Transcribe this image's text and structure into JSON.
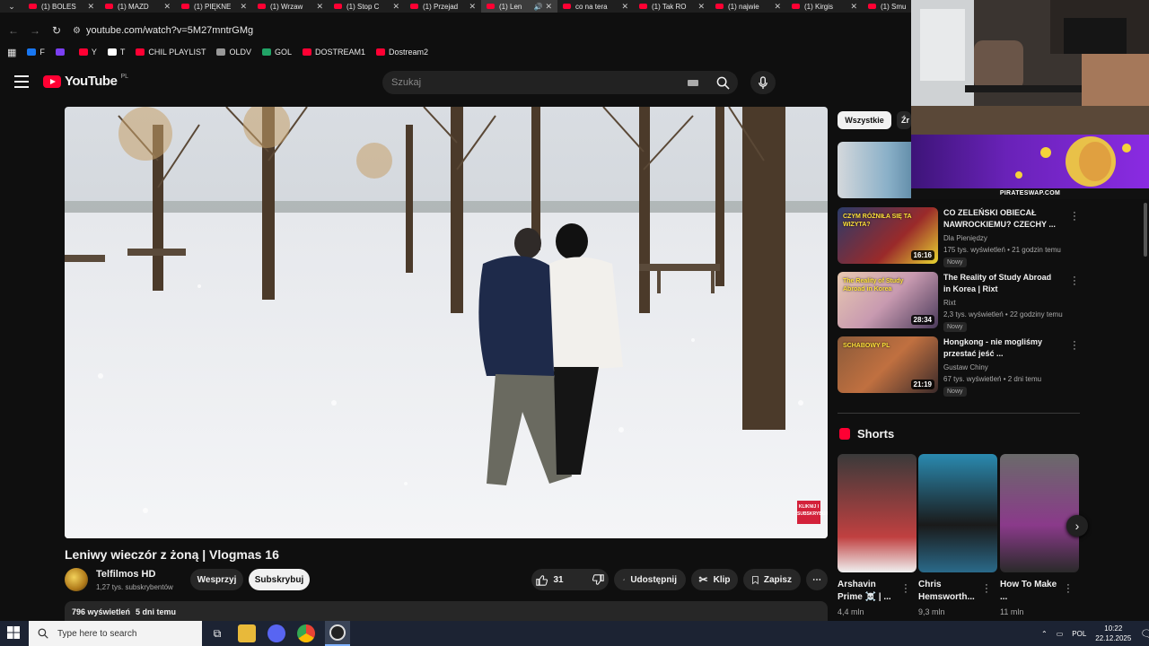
{
  "browser": {
    "tabs": [
      {
        "label": "(1) BOLES"
      },
      {
        "label": "(1) MAZD"
      },
      {
        "label": "(1) PIĘKNE"
      },
      {
        "label": "(1) Wrzaw"
      },
      {
        "label": "(1) Stop C"
      },
      {
        "label": "(1) Przejad"
      },
      {
        "label": "(1) Len",
        "active": true
      },
      {
        "label": "co na tera"
      },
      {
        "label": "(1) Tak RO"
      },
      {
        "label": "(1) najwie"
      },
      {
        "label": "(1) Kirgis"
      },
      {
        "label": "(1) Smu"
      }
    ],
    "url": "youtube.com/watch?v=5M27mntrGMg",
    "bookmarks": [
      {
        "label": "F",
        "color": "#1877f2"
      },
      {
        "label": "",
        "color": "#7b3ff2"
      },
      {
        "label": "Y",
        "color": "#ff0033"
      },
      {
        "label": "T",
        "color": "#ffffff"
      },
      {
        "label": "CHIL PLAYLIST",
        "color": "#ff0033"
      },
      {
        "label": "OLDV",
        "color": "#999999"
      },
      {
        "label": "GOL",
        "color": "#21a366"
      },
      {
        "label": "DOSTREAM1",
        "color": "#ff0033"
      },
      {
        "label": "Dostream2",
        "color": "#ff0033"
      }
    ]
  },
  "youtube": {
    "logo_text": "YouTube",
    "country_code": "PL",
    "search_placeholder": "Szukaj"
  },
  "video": {
    "title": "Leniwy wieczór z żoną | Vlogmas 16",
    "channel": "Telfilmos HD",
    "subscribers": "1,27 tys. subskrybentów",
    "support_label": "Wesprzyj",
    "subscribe_label": "Subskrybuj",
    "likes": "31",
    "share_label": "Udostępnij",
    "clip_label": "Klip",
    "save_label": "Zapisz",
    "views": "796 wyświetleń",
    "age": "5 dni temu",
    "overlay_text": "KLIKNIJ I SUBSKRYBUJ"
  },
  "filters": {
    "chip1": "Wszystkie",
    "chip2": "Źr"
  },
  "recommendations": [
    {
      "title": "CO ZELEŃSKI OBIECAŁ NAWROCKIEMU? CZECHY ...",
      "channel": "Dla Pieniędzy",
      "meta": "175 tys. wyświetleń • 21 godzin temu",
      "badge": "Nowy",
      "duration": "16:16",
      "thumb_text": "CZYM RÓŻNIŁA SIĘ TA WIZYTA?"
    },
    {
      "title": "The Reality of Study Abroad in Korea | Rixt",
      "channel": "Rixt",
      "meta": "2,3 tys. wyświetleń • 22 godziny temu",
      "badge": "Nowy",
      "duration": "28:34",
      "thumb_text": "The Reality of Study Abroad in Korea"
    },
    {
      "title": "Hongkong - nie mogliśmy przestać jeść ...",
      "channel": "Gustaw Chiny",
      "meta": "67 tys. wyświetleń • 2 dni temu",
      "badge": "Nowy",
      "duration": "21:19",
      "thumb_text": "SCHABOWY PL"
    }
  ],
  "shorts": {
    "label": "Shorts",
    "items": [
      {
        "title": "Arshavin Prime ☠️ | ...",
        "views": "4,4 mln"
      },
      {
        "title": "Chris Hemsworth...",
        "views": "9,3 mln"
      },
      {
        "title": "How To Make ...",
        "views": "11 mln"
      }
    ]
  },
  "ad": {
    "caption": "PIRATESWAP.COM"
  },
  "taskbar": {
    "search_placeholder": "Type here to search",
    "language": "POL",
    "time": "10:22",
    "date": "22.12.2025"
  }
}
